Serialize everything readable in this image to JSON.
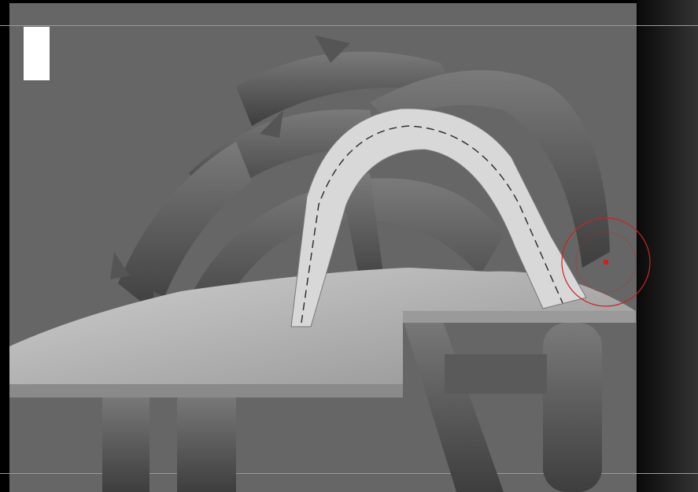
{
  "viewport": {
    "background": "#666666",
    "frame": "#000000"
  },
  "brush": {
    "cursor_color": "#cc2222",
    "icon": "brush-cursor-icon"
  },
  "color_swatch": {
    "color": "#ffffff"
  }
}
